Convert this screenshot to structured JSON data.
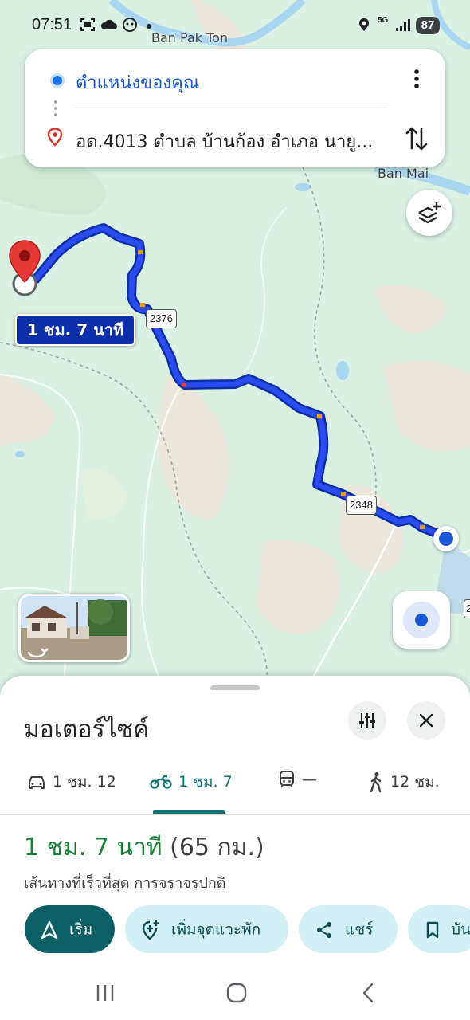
{
  "status_bar": {
    "time": "07:51",
    "network": "5G",
    "battery": "87"
  },
  "map": {
    "place_labels": [
      "Ban Pak Ton",
      "Ban Mai"
    ],
    "route_shields": [
      "2376",
      "2348"
    ],
    "eta_label": "1 ชม. 7 นาที",
    "partial_shield": "2"
  },
  "directions": {
    "origin": "ตำแหน่งของคุณ",
    "destination": "อด.4013 ตำบล บ้านก้อง อำเภอ นายู..."
  },
  "sheet": {
    "title": "มอเตอร์ไซค์",
    "modes": [
      {
        "icon": "car-icon",
        "label": "1 ชม. 12"
      },
      {
        "icon": "motorcycle-icon",
        "label": "1 ชม. 7",
        "active": true
      },
      {
        "icon": "transit-icon",
        "label": "—"
      },
      {
        "icon": "walk-icon",
        "label": "12 ชม."
      }
    ],
    "duration": "1 ชม. 7 นาที",
    "distance": "(65 กม.)",
    "route_note": "เส้นทางที่เร็วที่สุด การจราจรปกติ",
    "actions": {
      "start": "เริ่ม",
      "add_stop": "เพิ่มจุดแวะพัก",
      "share": "แชร์",
      "save": "บัน"
    }
  },
  "colors": {
    "route": "#1f3fe0",
    "route_outline": "#0b2fa8",
    "accent_teal": "#0d7377",
    "duration_green": "#188038",
    "map_bg": "#d9f0e2"
  }
}
